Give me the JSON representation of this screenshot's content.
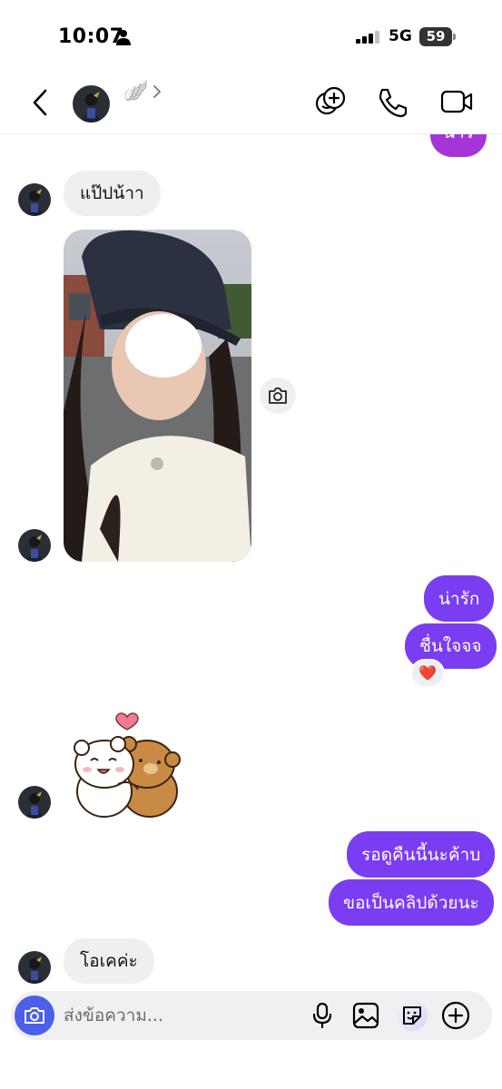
{
  "status_bar": {
    "time": "10:07",
    "network": "5G",
    "battery": "59"
  },
  "header": {
    "contact_emoji": "🪽"
  },
  "messages": {
    "top_partial": "น่ารั",
    "incoming_1": "แป๊ปน้าา",
    "outgoing_1": "น่ารัก",
    "outgoing_2": "ชื่นใจจจ",
    "reaction": "❤️",
    "outgoing_3": "รอดูคืนนี้นะค้าบ",
    "outgoing_4": "ขอเป็นคลิปด้วยนะ",
    "incoming_2": "โอเคค่ะ"
  },
  "composer": {
    "placeholder": "ส่งข้อความ..."
  },
  "colors": {
    "outgoing_purple": "#7b3ff2",
    "outgoing_magenta": "#a535d9",
    "incoming_bg": "#efeff1",
    "camera_blue": "#4b5fe8"
  },
  "icons": [
    "person-icon",
    "signal-icon",
    "back-icon",
    "chevron-right-icon",
    "video-effects-icon",
    "phone-icon",
    "video-camera-icon",
    "camera-icon",
    "mic-icon",
    "gallery-icon",
    "sticker-icon",
    "plus-icon",
    "heart-icon"
  ]
}
